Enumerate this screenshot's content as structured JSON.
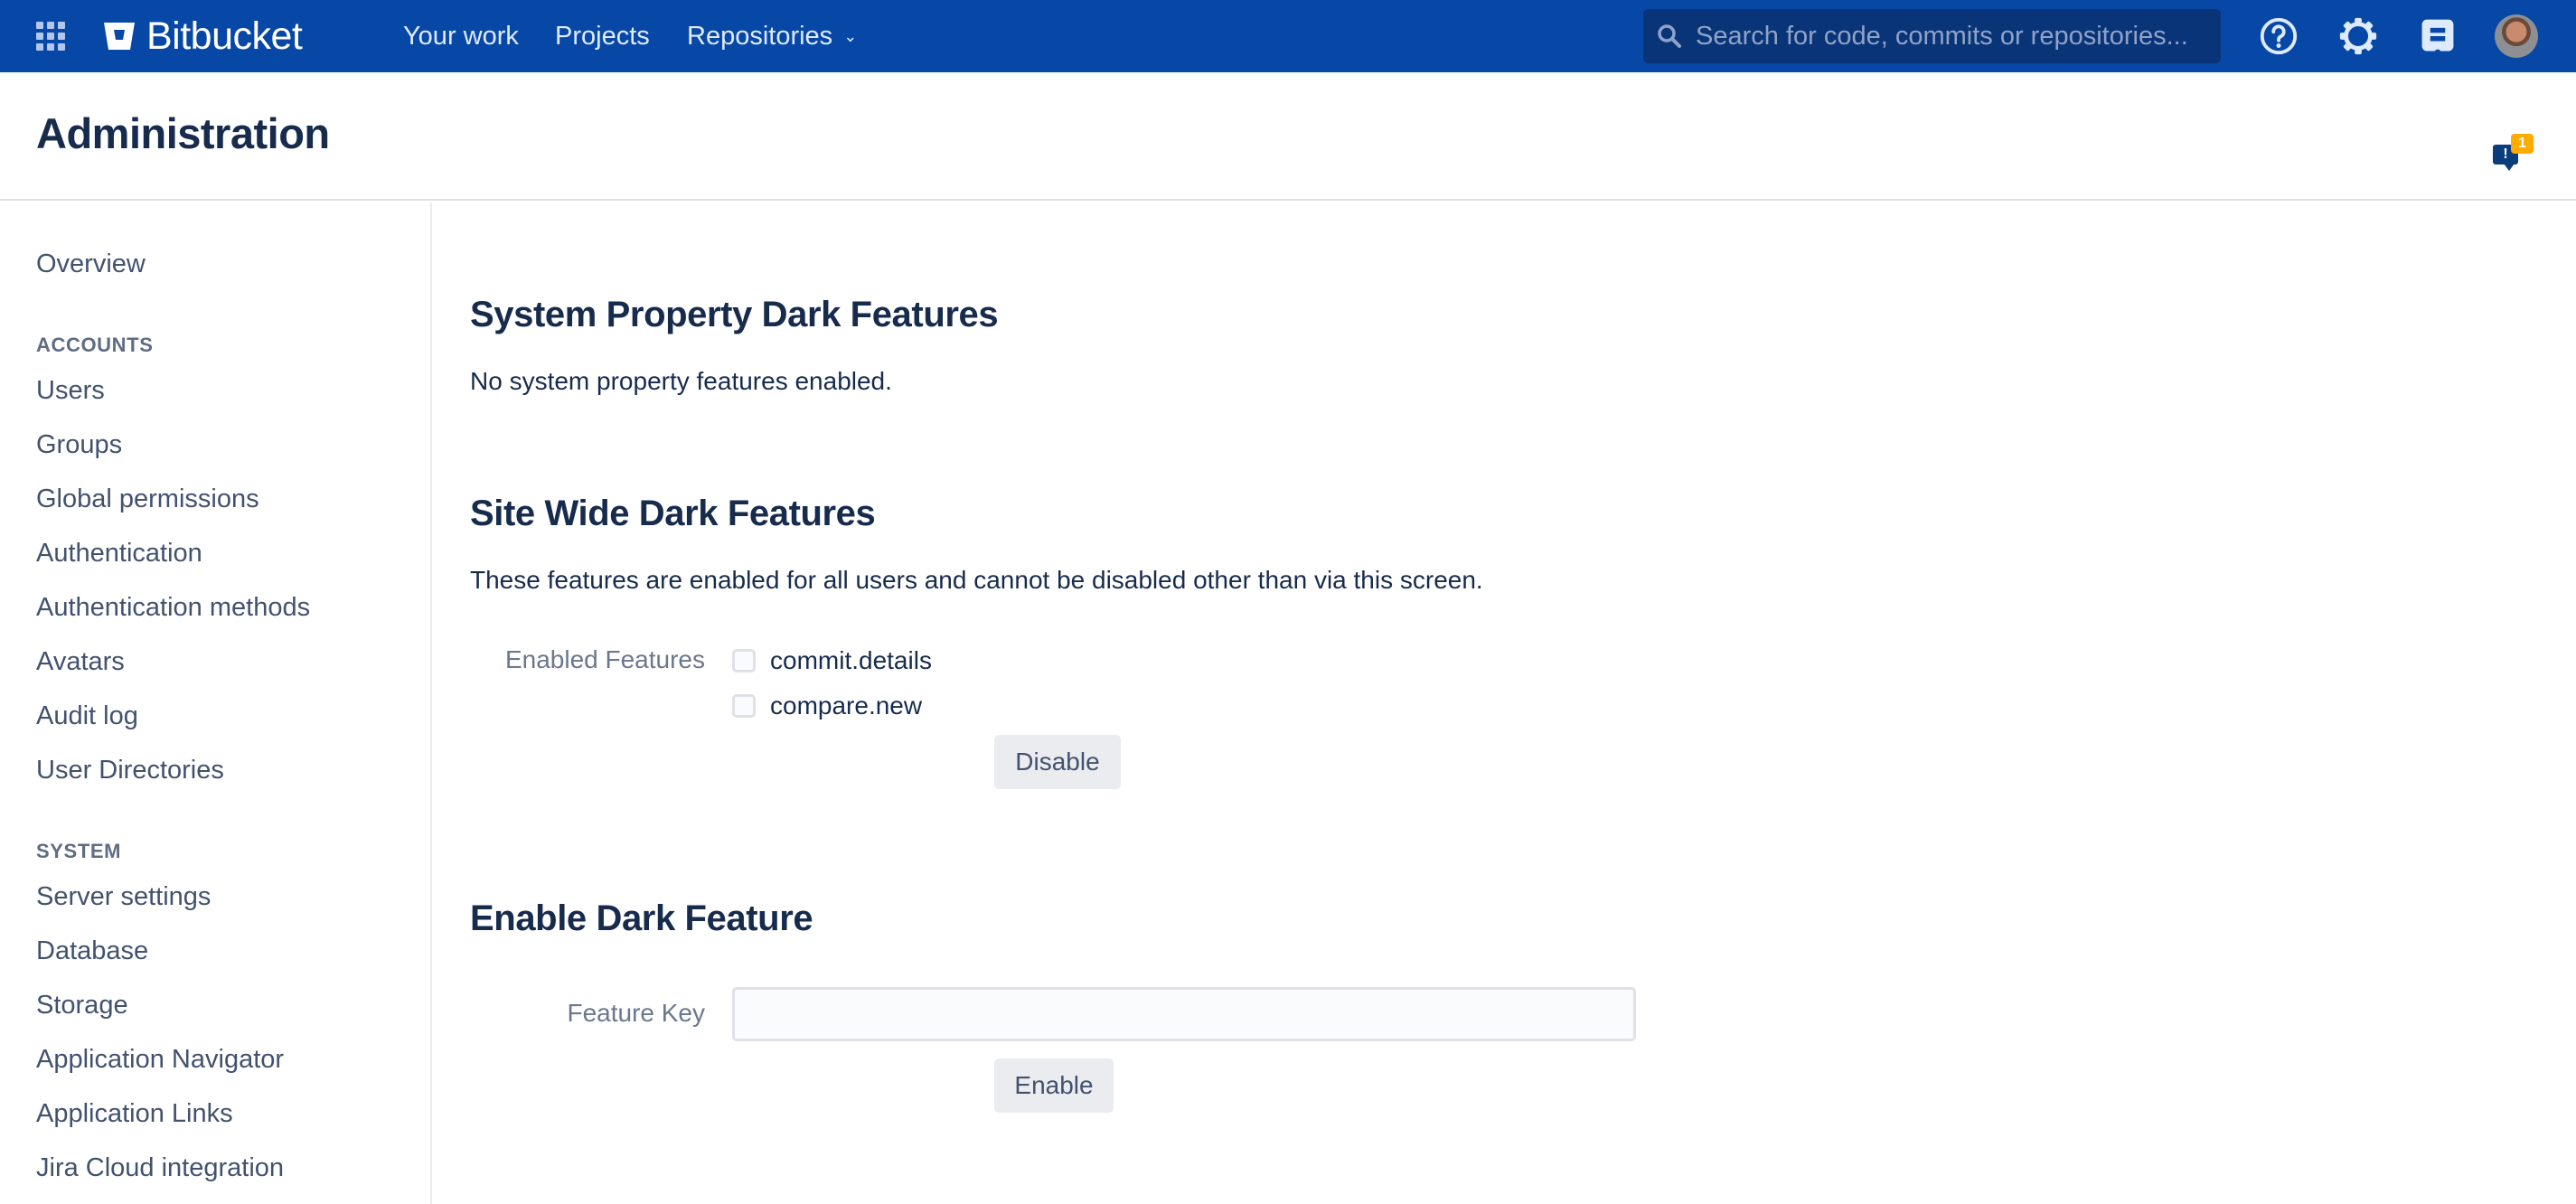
{
  "topnav": {
    "logo_text": "Bitbucket",
    "links": [
      {
        "label": "Your work"
      },
      {
        "label": "Projects"
      },
      {
        "label": "Repositories",
        "has_dropdown": true
      }
    ],
    "search": {
      "placeholder": "Search for code, commits or repositories...",
      "value": ""
    },
    "icons": [
      "help-icon",
      "settings-gear-icon",
      "whats-new-icon",
      "user-avatar"
    ],
    "brand_color": "#0747a6"
  },
  "header": {
    "title": "Administration",
    "feedback_badge_count": "1",
    "feedback_glyph": "!"
  },
  "sidebar": {
    "overview": "Overview",
    "sections": [
      {
        "heading": "ACCOUNTS",
        "items": [
          "Users",
          "Groups",
          "Global permissions",
          "Authentication",
          "Authentication methods",
          "Avatars",
          "Audit log",
          "User Directories"
        ]
      },
      {
        "heading": "SYSTEM",
        "items": [
          "Server settings",
          "Database",
          "Storage",
          "Application Navigator",
          "Application Links",
          "Jira Cloud integration"
        ]
      }
    ]
  },
  "main": {
    "system_property": {
      "heading": "System Property Dark Features",
      "text": "No system property features enabled."
    },
    "site_wide": {
      "heading": "Site Wide Dark Features",
      "text": "These features are enabled for all users and cannot be disabled other than via this screen.",
      "field_label": "Enabled Features",
      "features": [
        {
          "key": "commit.details",
          "checked": false
        },
        {
          "key": "compare.new",
          "checked": false
        }
      ],
      "disable_label": "Disable"
    },
    "enable": {
      "heading": "Enable Dark Feature",
      "field_label": "Feature Key",
      "input_value": "",
      "enable_label": "Enable"
    }
  }
}
